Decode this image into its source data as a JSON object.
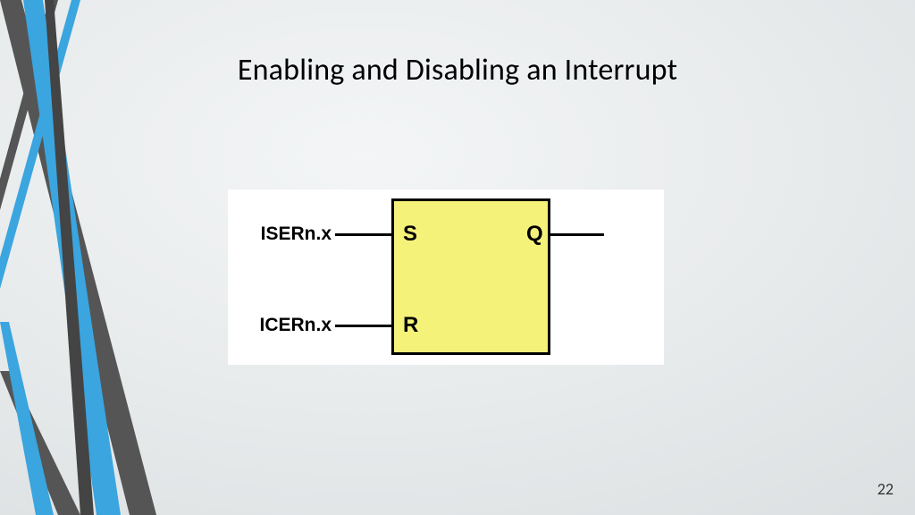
{
  "title": "Enabling and Disabling an Interrupt",
  "page_number": "22",
  "diagram": {
    "input_set_label": "ISERn.x",
    "input_reset_label": "ICERn.x",
    "pin_S": "S",
    "pin_R": "R",
    "pin_Q": "Q"
  },
  "colors": {
    "accent_blue": "#3aa5df",
    "accent_dark": "#444444",
    "sr_fill": "#f5f27a"
  }
}
